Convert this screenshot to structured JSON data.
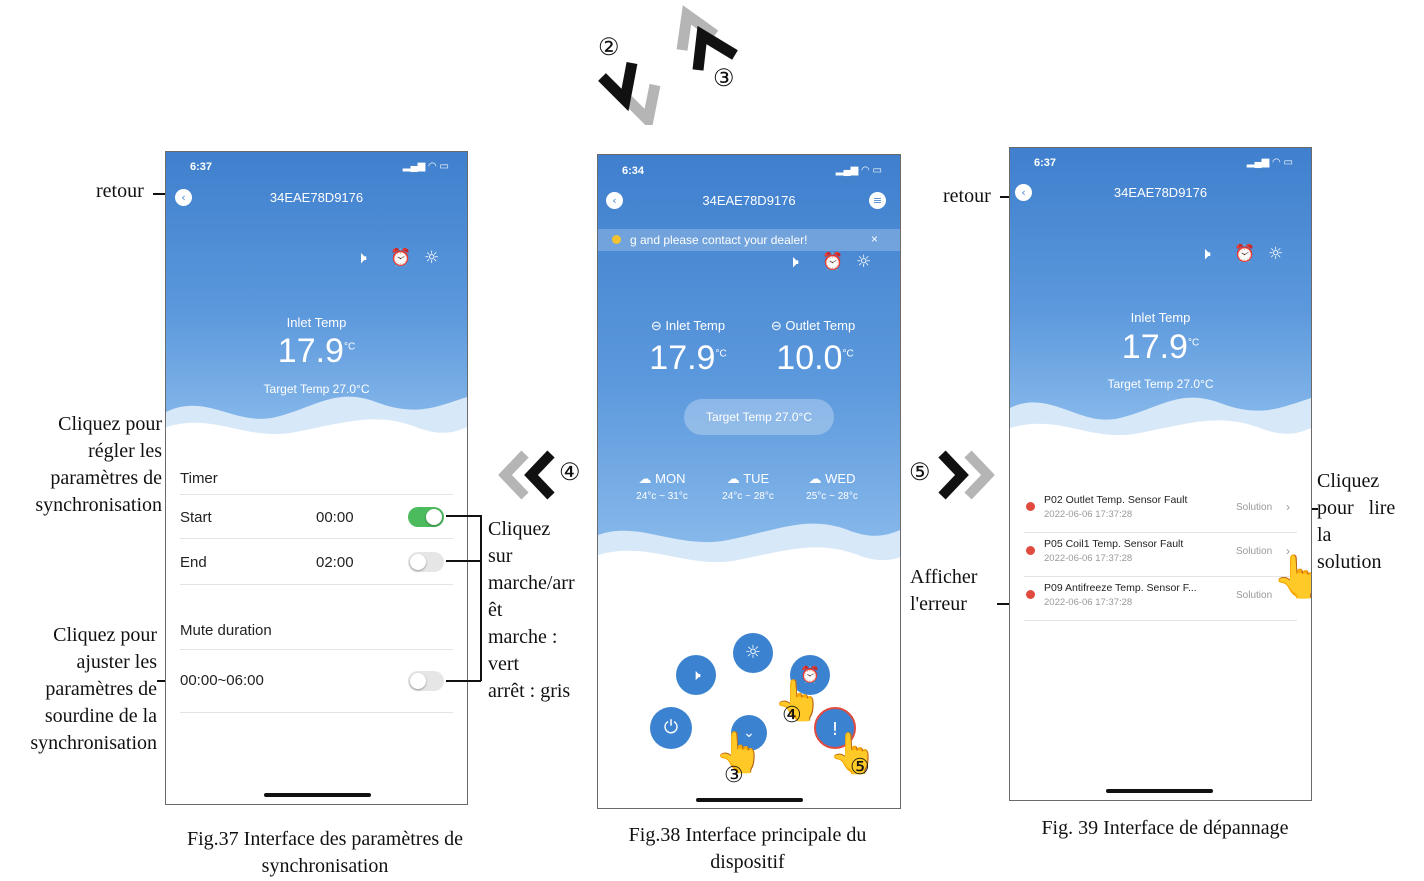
{
  "steps": {
    "s2": "②",
    "s3": "③",
    "s4": "④",
    "s5": "⑤"
  },
  "fig37": {
    "time": "6:37",
    "title": "34EAE78D9176",
    "inlet_label": "Inlet Temp",
    "inlet_value": "17.9",
    "unit": "°C",
    "target": "Target Temp  27.0°C",
    "timer_label": "Timer",
    "start_label": "Start",
    "start_value": "00:00",
    "end_label": "End",
    "end_value": "02:00",
    "mute_label": "Mute duration",
    "mute_value": "00:00~06:00",
    "caption": "Fig.37 Interface des paramètres de synchronisation"
  },
  "fig38": {
    "time": "6:34",
    "title": "34EAE78D9176",
    "notice": "g and please contact your dealer!",
    "inlet_label": "Inlet Temp",
    "outlet_label": "Outlet Temp",
    "inlet_value": "17.9",
    "outlet_value": "10.0",
    "unit": "°C",
    "target_button": "Target Temp  27.0°C",
    "forecast": [
      {
        "day": "MON",
        "range": "24°c ~ 31°c"
      },
      {
        "day": "TUE",
        "range": "24°c ~ 28°c"
      },
      {
        "day": "WED",
        "range": "25°c ~ 28°c"
      }
    ],
    "caption": "Fig.38 Interface principale du dispositif"
  },
  "fig39": {
    "time": "6:37",
    "title": "34EAE78D9176",
    "inlet_label": "Inlet Temp",
    "inlet_value": "17.9",
    "unit": "°C",
    "target": "Target Temp  27.0°C",
    "errors": [
      {
        "name": "P02 Outlet Temp. Sensor Fault",
        "time": "2022-06-06 17:37:28",
        "action": "Solution"
      },
      {
        "name": "P05 Coil1 Temp. Sensor Fault",
        "time": "2022-06-06 17:37:28",
        "action": "Solution"
      },
      {
        "name": "P09 Antifreeze Temp. Sensor F...",
        "time": "2022-06-06 17:37:28",
        "action": "Solution"
      }
    ],
    "caption": "Fig. 39 Interface de dépannage"
  },
  "annotations": {
    "retour_left": "retour",
    "retour_right": "retour",
    "sync_settings": [
      "Cliquez pour",
      "régler les",
      "paramètres de",
      "synchronisation"
    ],
    "mute_settings": [
      "Cliquez pour",
      "ajuster les",
      "paramètres de",
      "sourdine de la",
      "synchronisation"
    ],
    "onoff": [
      "Cliquez",
      "sur",
      "marche/arr",
      "êt",
      "marche :",
      "vert",
      "arrêt : gris"
    ],
    "solution": [
      "Cliquez",
      "pour   lire",
      "la",
      "solution"
    ],
    "error_view": [
      "Afficher",
      "l'erreur"
    ]
  },
  "colors": {
    "sky": "#3f7fcd",
    "toggle_on": "#4cbb5e",
    "error_red": "#e04a3f",
    "button_blue": "#3b83d0"
  }
}
